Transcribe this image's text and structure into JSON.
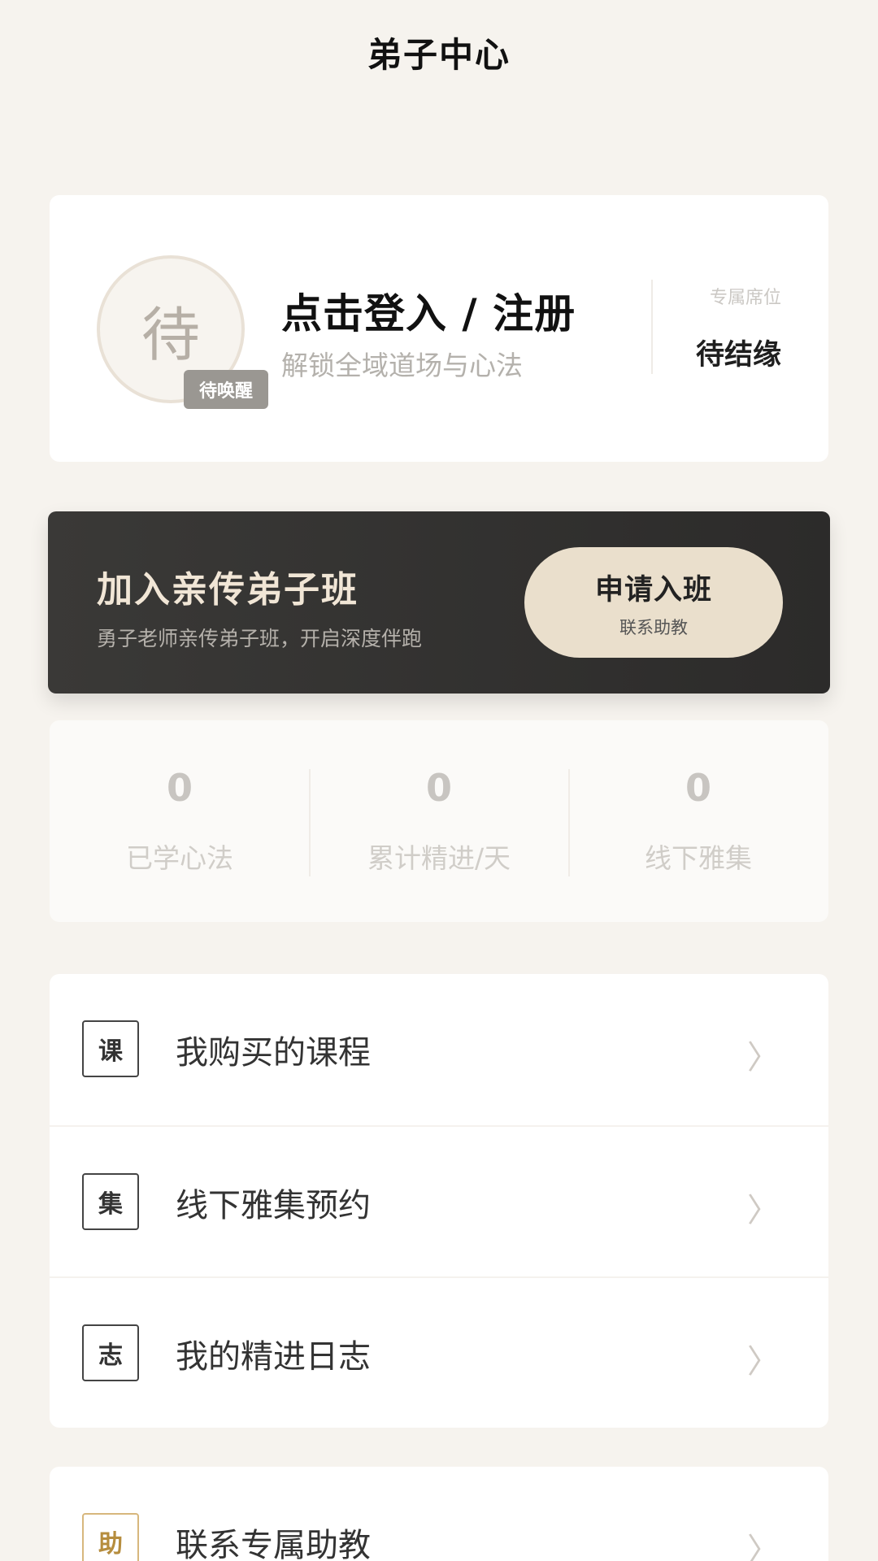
{
  "header": {
    "title": "弟子中心"
  },
  "profile": {
    "avatar_char": "待",
    "badge": "待唤醒",
    "login_title": "点击登入 / 注册",
    "login_subtitle": "解锁全域道场与心法",
    "seat_label": "专属席位",
    "seat_value": "待结缘"
  },
  "banner": {
    "title": "加入亲传弟子班",
    "subtitle": "勇子老师亲传弟子班，开启深度伴跑",
    "button_label": "申请入班",
    "button_sublabel": "联系助教"
  },
  "stats": [
    {
      "value": "0",
      "label": "已学心法"
    },
    {
      "value": "0",
      "label": "累计精进/天"
    },
    {
      "value": "0",
      "label": "线下雅集"
    }
  ],
  "menu": [
    {
      "icon": "课",
      "label": "我购买的课程"
    },
    {
      "icon": "集",
      "label": "线下雅集预约"
    },
    {
      "icon": "志",
      "label": "我的精进日志"
    }
  ],
  "menu_2": [
    {
      "icon": "助",
      "label": "联系专属助教"
    }
  ],
  "icons": {
    "chevron": "〉"
  },
  "colors": {
    "background": "#f6f3ee",
    "banner_dark": "#2c2b2a",
    "accent_beige": "#eadfcc",
    "accent_gold": "#d7b77d"
  }
}
